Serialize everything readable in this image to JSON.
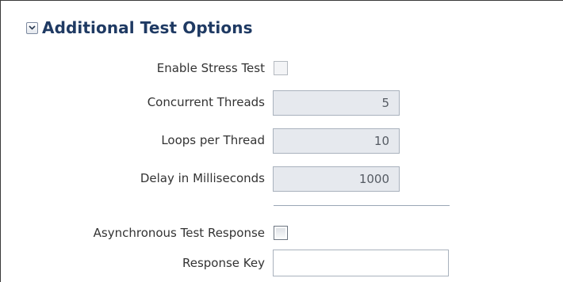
{
  "section": {
    "title": "Additional Test Options",
    "expanded": true,
    "icon": "chevron-down-icon"
  },
  "fields": {
    "enable_stress_test": {
      "label": "Enable Stress Test",
      "checked": false,
      "disabled": true
    },
    "concurrent_threads": {
      "label": "Concurrent Threads",
      "value": "5",
      "disabled": true
    },
    "loops_per_thread": {
      "label": "Loops per Thread",
      "value": "10",
      "disabled": true
    },
    "delay_ms": {
      "label": "Delay in Milliseconds",
      "value": "1000",
      "disabled": true
    },
    "async_response": {
      "label": "Asynchronous Test Response",
      "checked": false,
      "disabled": false
    },
    "response_key": {
      "label": "Response Key",
      "value": ""
    }
  },
  "colors": {
    "title": "#1f3a63",
    "label": "#333333",
    "disabled_field_bg": "#e6e9ee",
    "field_border": "#a9b2bd"
  }
}
